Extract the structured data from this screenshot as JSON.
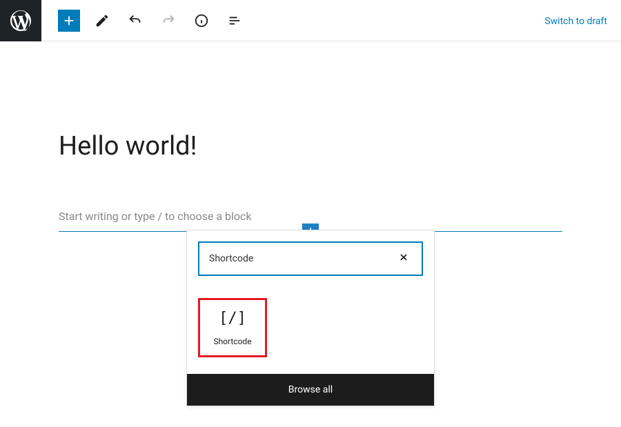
{
  "toolbar": {
    "switch_to_draft": "Switch to draft"
  },
  "editor": {
    "title": "Hello world!",
    "placeholder": "Start writing or type / to choose a block"
  },
  "inserter": {
    "search_value": "Shortcode",
    "blocks": [
      {
        "icon": "[/]",
        "label": "Shortcode"
      }
    ],
    "browse_all": "Browse all"
  }
}
